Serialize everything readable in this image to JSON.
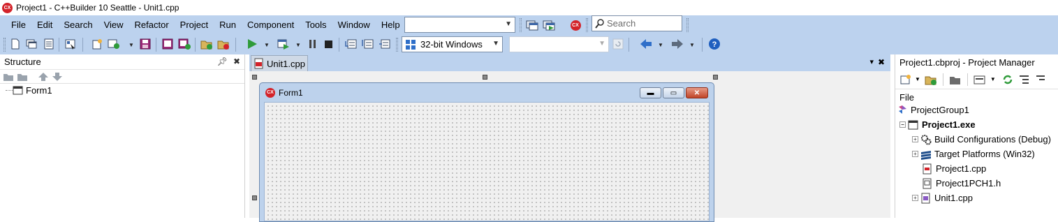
{
  "window": {
    "title": "Project1 - C++Builder 10 Seattle - Unit1.cpp",
    "logo_text": "CX"
  },
  "menu": {
    "items": [
      "File",
      "Edit",
      "Search",
      "View",
      "Refactor",
      "Project",
      "Run",
      "Component",
      "Tools",
      "Window",
      "Help"
    ]
  },
  "toolbar": {
    "desktop_combo_value": "",
    "search_placeholder": "Search",
    "platform_value": "32-bit Windows",
    "config_combo_value": ""
  },
  "structure": {
    "title": "Structure",
    "tree": [
      {
        "label": "Form1"
      }
    ]
  },
  "editor": {
    "tab_label": "Unit1.cpp",
    "form": {
      "caption": "Form1",
      "logo_text": "CX"
    }
  },
  "project_manager": {
    "title": "Project1.cbproj - Project Manager",
    "column_header": "File",
    "tree": [
      {
        "label": "ProjectGroup1"
      },
      {
        "label": "Project1.exe"
      },
      {
        "label": "Build Configurations (Debug)"
      },
      {
        "label": "Target Platforms (Win32)"
      },
      {
        "label": "Project1.cpp"
      },
      {
        "label": "Project1PCH1.h"
      },
      {
        "label": "Unit1.cpp"
      }
    ]
  },
  "colors": {
    "chrome": "#bcd2ee",
    "brand_red": "#d3232a",
    "run_green": "#2f9b3a",
    "nav_blue": "#2f6fc9"
  }
}
